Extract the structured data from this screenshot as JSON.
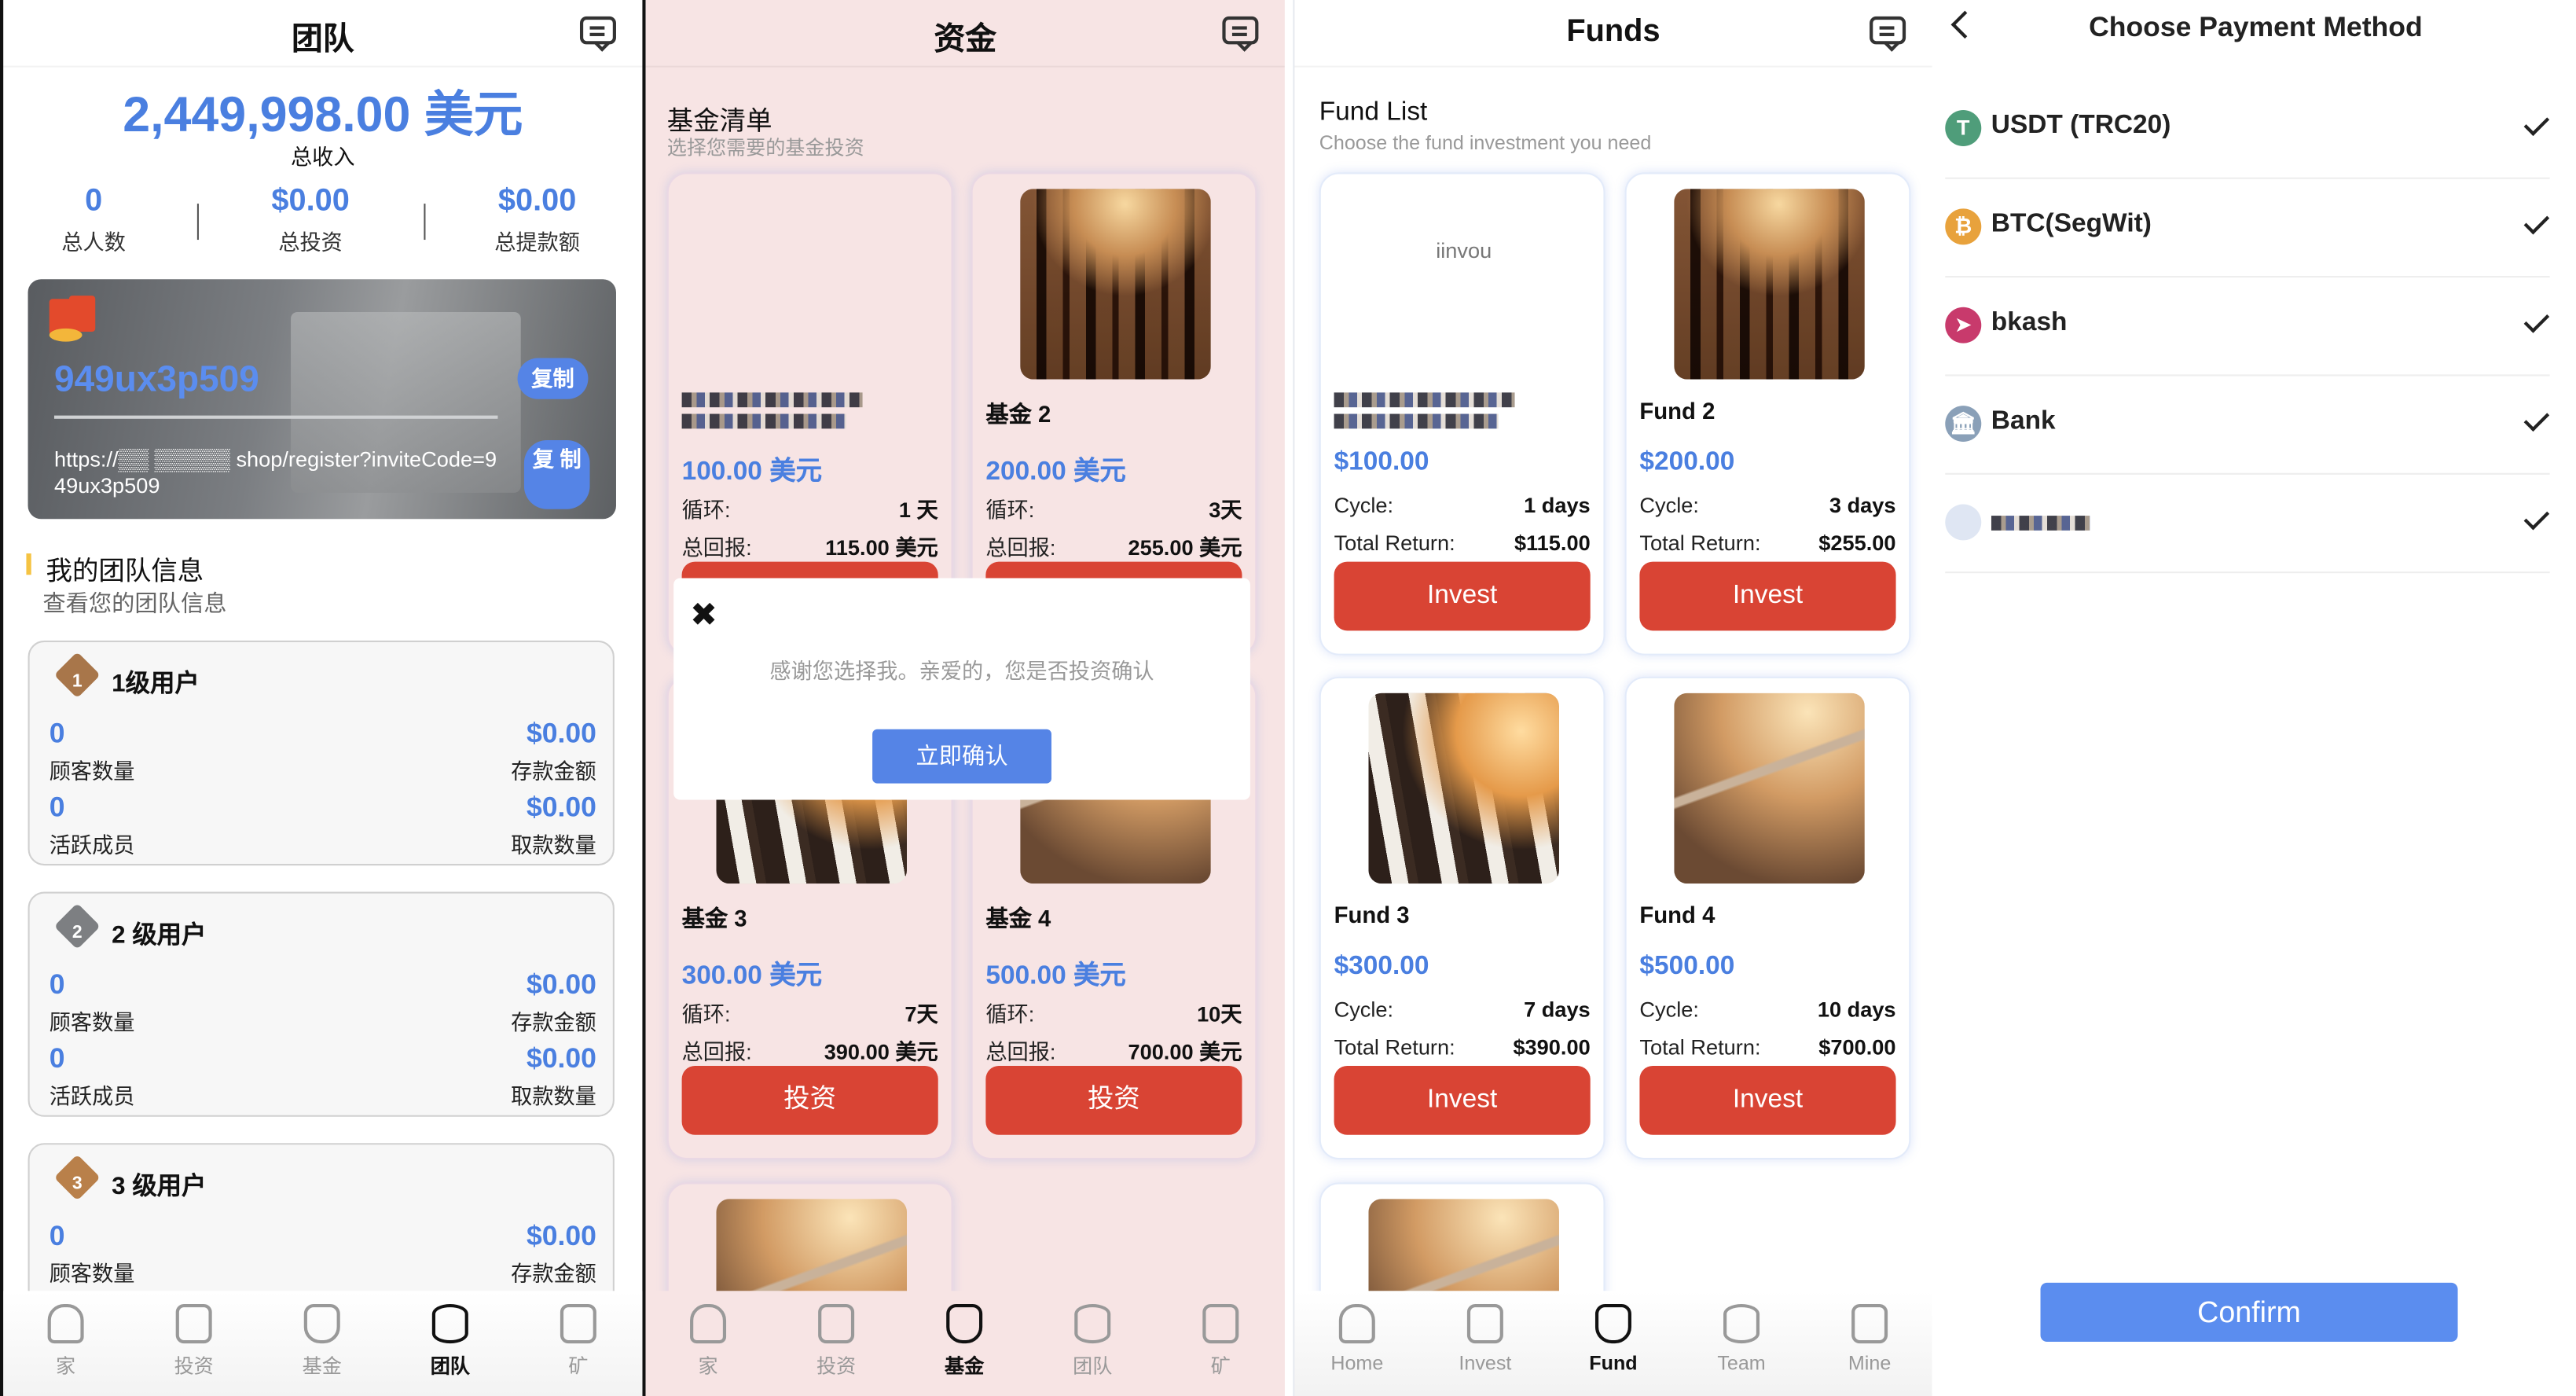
{
  "colors": {
    "accent_blue": "#4a7fe0",
    "invest_red": "#d94434",
    "pink_bg": "#f7e4e4",
    "confirm_blue": "#5b8def"
  },
  "team": {
    "title": "团队",
    "total_income": "2,449,998.00 美元",
    "total_income_label": "总收入",
    "stats": [
      {
        "value": "0",
        "label": "总人数"
      },
      {
        "value": "$0.00",
        "label": "总投资"
      },
      {
        "value": "$0.00",
        "label": "总提款额"
      }
    ],
    "invite_code": "949ux3p509",
    "copy_label": "复制",
    "invite_url": "https://▒▒ ▒▒▒▒▒ shop/register?inviteCode=949ux3p509",
    "copy_label_2": "复 制",
    "section_title": "我的团队信息",
    "section_subtitle": "查看您的团队信息",
    "levels": [
      {
        "badge": "1",
        "name": "1级用户",
        "customers": "0",
        "customers_label": "顾客数量",
        "deposit": "$0.00",
        "deposit_label": "存款金额",
        "active": "0",
        "active_label": "活跃成员",
        "withdraw": "$0.00",
        "withdraw_label": "取款数量"
      },
      {
        "badge": "2",
        "name": "2 级用户",
        "customers": "0",
        "customers_label": "顾客数量",
        "deposit": "$0.00",
        "deposit_label": "存款金额",
        "active": "0",
        "active_label": "活跃成员",
        "withdraw": "$0.00",
        "withdraw_label": "取款数量"
      },
      {
        "badge": "3",
        "name": "3 级用户",
        "customers": "0",
        "customers_label": "顾客数量",
        "deposit": "$0.00",
        "deposit_label": "存款金额"
      }
    ],
    "nav": [
      {
        "label": "家",
        "icon": "home-icon"
      },
      {
        "label": "投资",
        "icon": "document-icon"
      },
      {
        "label": "基金",
        "icon": "money-bag-icon"
      },
      {
        "label": "团队",
        "icon": "coins-icon",
        "active": true
      },
      {
        "label": "矿",
        "icon": "id-card-icon"
      }
    ]
  },
  "funds_cn": {
    "title": "资金",
    "list_title": "基金清单",
    "list_subtitle": "选择您需要的基金投资",
    "cycle_label": "循环:",
    "return_label": "总回报:",
    "invest_label": "投资",
    "cards": [
      {
        "name": "",
        "price": "100.00 美元",
        "cycle": "1 天",
        "return": "115.00 美元",
        "image": "blank"
      },
      {
        "name": "基金 2",
        "price": "200.00 美元",
        "cycle": "3天",
        "return": "255.00 美元",
        "image": "cow1"
      },
      {
        "name": "基金 3",
        "price": "300.00 美元",
        "cycle": "7天",
        "return": "390.00 美元",
        "image": "cow2"
      },
      {
        "name": "基金 4",
        "price": "500.00 美元",
        "cycle": "10天",
        "return": "700.00 美元",
        "image": "cow3"
      }
    ],
    "modal": {
      "message": "感谢您选择我。亲爱的，您是否投资确认",
      "confirm_label": "立即确认"
    },
    "nav": [
      {
        "label": "家",
        "icon": "home-icon"
      },
      {
        "label": "投资",
        "icon": "document-icon"
      },
      {
        "label": "基金",
        "icon": "money-bag-icon",
        "active": true
      },
      {
        "label": "团队",
        "icon": "coins-icon"
      },
      {
        "label": "矿",
        "icon": "id-card-icon"
      }
    ]
  },
  "funds_en": {
    "title": "Funds",
    "list_title": "Fund List",
    "list_subtitle": "Choose the fund investment you need",
    "cycle_label": "Cycle:",
    "return_label": "Total Return:",
    "invest_label": "Invest",
    "cards": [
      {
        "name": "",
        "price": "$100.00",
        "cycle": "1 days",
        "return": "$115.00",
        "image": "blank",
        "watermark": "iinvou"
      },
      {
        "name": "Fund 2",
        "price": "$200.00",
        "cycle": "3 days",
        "return": "$255.00",
        "image": "cow1"
      },
      {
        "name": "Fund 3",
        "price": "$300.00",
        "cycle": "7 days",
        "return": "$390.00",
        "image": "cow2"
      },
      {
        "name": "Fund 4",
        "price": "$500.00",
        "cycle": "10 days",
        "return": "$700.00",
        "image": "cow3"
      }
    ],
    "nav": [
      {
        "label": "Home",
        "icon": "home-icon"
      },
      {
        "label": "Invest",
        "icon": "document-icon"
      },
      {
        "label": "Fund",
        "icon": "money-bag-icon",
        "active": true
      },
      {
        "label": "Team",
        "icon": "coins-icon"
      },
      {
        "label": "Mine",
        "icon": "id-card-icon"
      }
    ]
  },
  "payment": {
    "title": "Choose Payment Method",
    "methods": [
      {
        "label": "USDT (TRC20)",
        "icon": "tether-icon",
        "color": "#4f9d7a",
        "glyph": "T",
        "selected": true
      },
      {
        "label": "BTC(SegWit)",
        "icon": "bitcoin-icon",
        "color": "#e8a23c",
        "glyph": "₿",
        "selected": true
      },
      {
        "label": "bkash",
        "icon": "bkash-icon",
        "color": "#c83a6c",
        "glyph": "➤",
        "selected": true
      },
      {
        "label": "Bank",
        "icon": "bank-icon",
        "color": "#8aa0b8",
        "glyph": "🏛",
        "selected": true
      },
      {
        "label": "",
        "icon": "redacted-icon",
        "color": "#dfe6f3",
        "glyph": "",
        "selected": true
      }
    ],
    "confirm_label": "Confirm"
  }
}
